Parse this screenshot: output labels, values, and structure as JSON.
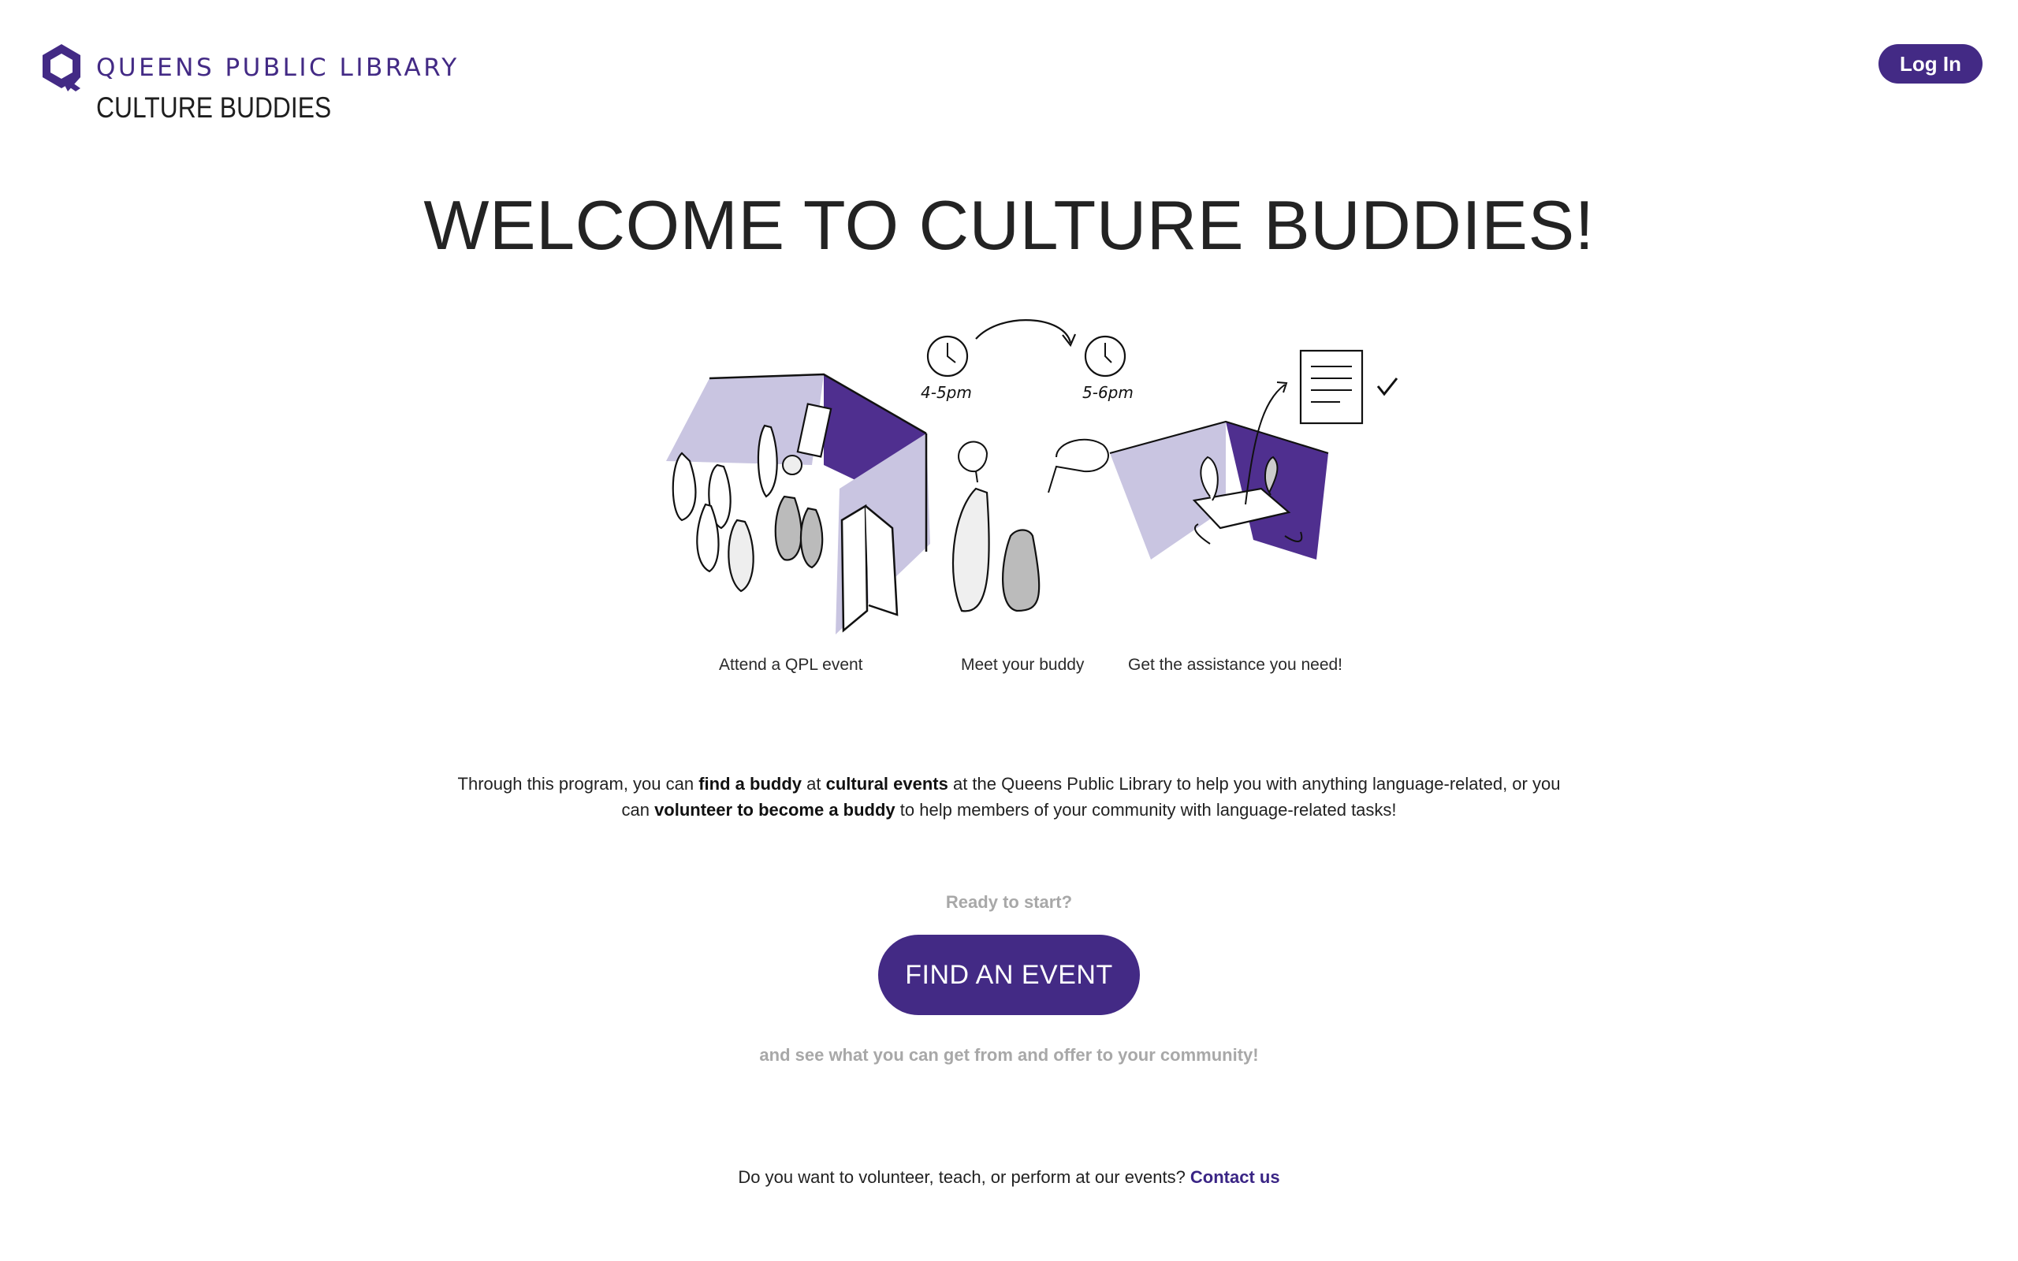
{
  "header": {
    "brand_name": "QUEENS PUBLIC LIBRARY",
    "app_name": "CULTURE BUDDIES",
    "login_label": "Log In"
  },
  "hero": {
    "title": "WELCOME TO CULTURE BUDDIES!"
  },
  "steps": [
    {
      "caption": "Attend a QPL event"
    },
    {
      "caption": "Meet your buddy",
      "time_before": "4-5pm",
      "time_after": "5-6pm"
    },
    {
      "caption": "Get the assistance you need!"
    }
  ],
  "description": {
    "part1": "Through this program, you can ",
    "bold1": "find a buddy",
    "part2": " at ",
    "bold2": "cultural events",
    "part3": " at the Queens Public Library to help you with anything language-related, or you can ",
    "bold3": "volunteer to become a buddy",
    "part4": " to help members of your community with language-related tasks!"
  },
  "cta": {
    "prompt": "Ready to start?",
    "button_label": "FIND AN EVENT",
    "subtext": "and see what you can get from and offer to your community!"
  },
  "footer": {
    "question": "Do you want to volunteer, teach, or perform at our events? ",
    "contact_label": "Contact us"
  },
  "colors": {
    "brand_purple": "#432a85",
    "light_purple": "#c9c5e1",
    "dark_purple": "#4f2f8f",
    "muted_text": "#a8a8a8"
  }
}
